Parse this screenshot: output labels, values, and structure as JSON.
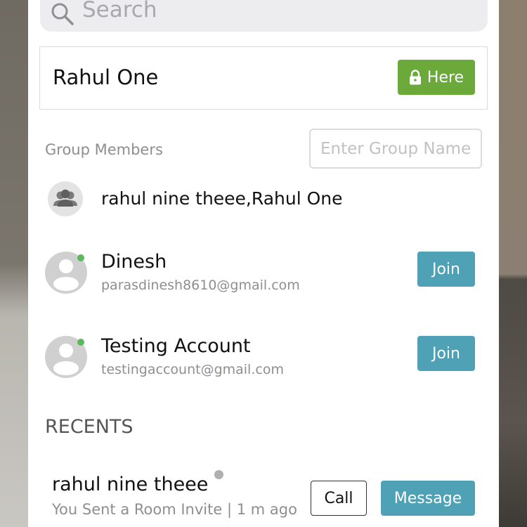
{
  "search": {
    "placeholder": "Search"
  },
  "room": {
    "name": "Rahul One",
    "here_label": "Here"
  },
  "group": {
    "members_label": "Group Members",
    "name_placeholder": "Enter Group Name",
    "member_names": "rahul nine theee,Rahul One"
  },
  "contacts": [
    {
      "name": "Dinesh",
      "email": "parasdinesh8610@gmail.com",
      "action_label": "Join",
      "online": true
    },
    {
      "name": "Testing Account",
      "email": "testingaccount@gmail.com",
      "action_label": "Join",
      "online": true
    }
  ],
  "recents": {
    "heading": "RECENTS",
    "items": [
      {
        "name": "rahul nine theee",
        "status": "You Sent a Room Invite | 1 m ago",
        "call_label": "Call",
        "message_label": "Message"
      }
    ]
  },
  "colors": {
    "here_green": "#6aa93a",
    "join_teal": "#4fa1b5",
    "online_green": "#5cb85c"
  },
  "icons": [
    "search-icon",
    "lock-icon",
    "group-icon",
    "person-icon"
  ]
}
